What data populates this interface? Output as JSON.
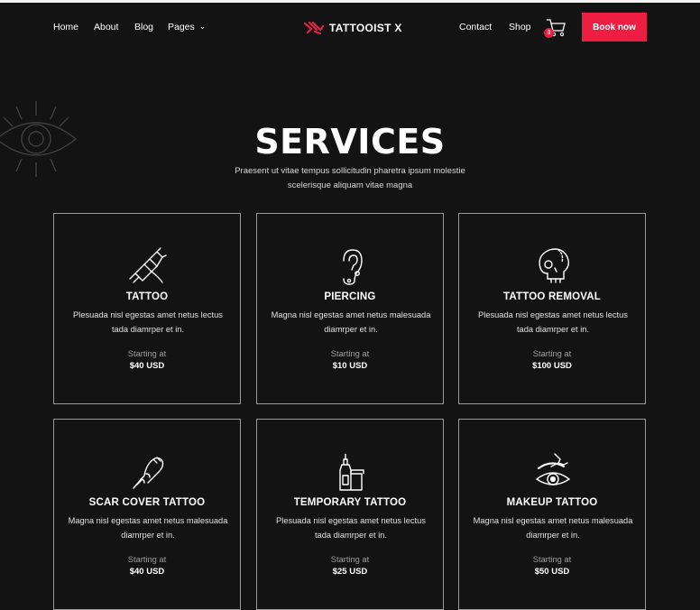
{
  "nav": {
    "left": [
      "Home",
      "About",
      "Blog",
      "Pages"
    ],
    "right": [
      "Contact",
      "Shop"
    ],
    "brand": "TATTOOIST X",
    "cart_count": "3",
    "book_label": "Book now"
  },
  "hero": {
    "title": "SERVICES",
    "subtitle": "Praesent ut vitae tempus sollicitudin pharetra ipsum molestie scelerisque aliquam vitae magna"
  },
  "services": [
    {
      "name": "TATTOO",
      "icon": "tattoo-machine-icon",
      "desc": "Plesuada nisl egestas amet netus lectus tada diamrper et in.",
      "starting": "Starting at",
      "price": "$40 USD"
    },
    {
      "name": "PIERCING",
      "icon": "ear-piercing-icon",
      "desc": "Magna nisl egestas amet netus malesuada diamrper et in.",
      "starting": "Starting at",
      "price": "$10 USD"
    },
    {
      "name": "TATTOO REMOVAL",
      "icon": "skull-icon",
      "desc": "Plesuada nisl egestas amet netus lectus tada diamrper et in.",
      "starting": "Starting at",
      "price": "$100 USD"
    },
    {
      "name": "SCAR COVER TATTOO",
      "icon": "tattooed-arm-icon",
      "desc": "Magna nisl egestas amet netus malesuada diamrper et in.",
      "starting": "Starting at",
      "price": "$40 USD"
    },
    {
      "name": "TEMPORARY TATTOO",
      "icon": "ink-bottle-icon",
      "desc": "Plesuada nisl egestas amet netus lectus tada diamrper et in.",
      "starting": "Starting at",
      "price": "$25 USD"
    },
    {
      "name": "MAKEUP TATTOO",
      "icon": "eyebrow-eye-icon",
      "desc": "Magna nisl egestas amet netus malesuada diamrper et in.",
      "starting": "Starting at",
      "price": "$50 USD"
    }
  ],
  "colors": {
    "background": "#131314",
    "accent": "#ee1e43",
    "border": "#9a9a9a"
  }
}
